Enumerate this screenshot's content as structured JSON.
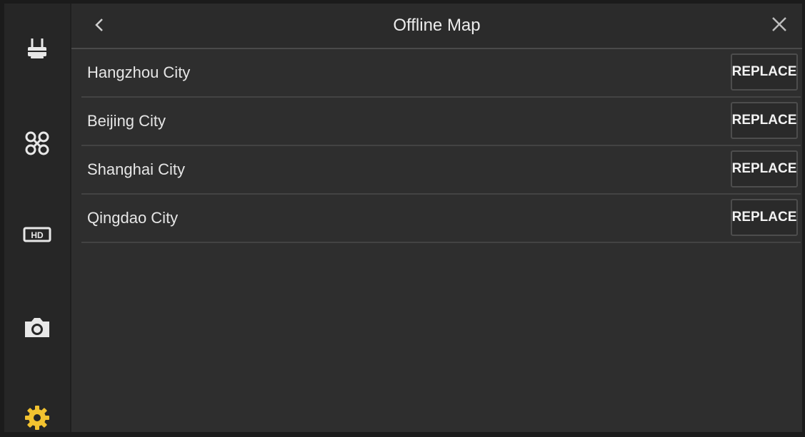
{
  "header": {
    "title": "Offline Map",
    "back_icon": "chevron-left-icon",
    "close_icon": "close-icon"
  },
  "sidebar": {
    "items": [
      {
        "icon": "remote-controller-icon",
        "active": false
      },
      {
        "icon": "drone-icon",
        "active": false
      },
      {
        "icon": "hd-video-icon",
        "active": false
      },
      {
        "icon": "camera-icon",
        "active": false
      },
      {
        "icon": "gear-icon",
        "active": true
      }
    ],
    "active_color": "#f2c230",
    "icon_color": "#e8e8e8"
  },
  "maps": [
    {
      "name": "Hangzhou City",
      "action": "REPLACE"
    },
    {
      "name": "Beijing City",
      "action": "REPLACE"
    },
    {
      "name": "Shanghai City",
      "action": "REPLACE"
    },
    {
      "name": "Qingdao City",
      "action": "REPLACE"
    }
  ]
}
